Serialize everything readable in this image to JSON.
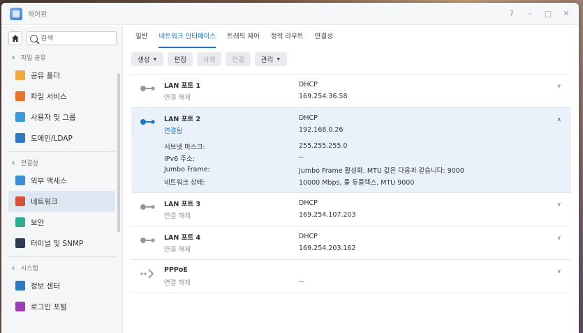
{
  "window": {
    "title": "제어판",
    "controls": [
      "?",
      "–",
      "□",
      "✕"
    ]
  },
  "sidebar": {
    "search_placeholder": "검색",
    "groups": [
      {
        "label": "파일 공유",
        "items": [
          {
            "label": "공유 폴더",
            "color": "#f2a93b"
          },
          {
            "label": "파일 서비스",
            "color": "#e8742b"
          },
          {
            "label": "사용자 및 그룹",
            "color": "#3a9bd9"
          },
          {
            "label": "도메인/LDAP",
            "color": "#2f78c4"
          }
        ]
      },
      {
        "label": "연결성",
        "items": [
          {
            "label": "외부 액세스",
            "color": "#3b8fd6"
          },
          {
            "label": "네트워크",
            "color": "#d5533b",
            "active": true
          },
          {
            "label": "보안",
            "color": "#2fae8f"
          },
          {
            "label": "터미널 및 SNMP",
            "color": "#2c3e55"
          }
        ]
      },
      {
        "label": "시스템",
        "items": [
          {
            "label": "정보 센터",
            "color": "#2f78c4"
          },
          {
            "label": "로그인 포털",
            "color": "#9b3fb5"
          }
        ]
      }
    ]
  },
  "tabs": [
    {
      "label": "일반",
      "active": false
    },
    {
      "label": "네트워크 인터페이스",
      "active": true
    },
    {
      "label": "트래픽 제어",
      "active": false
    },
    {
      "label": "정적 라우트",
      "active": false
    },
    {
      "label": "연결성",
      "active": false
    }
  ],
  "toolbar": {
    "create": "생성",
    "edit": "편집",
    "delete": "삭제",
    "connect": "연결",
    "manage": "관리"
  },
  "interfaces": [
    {
      "name": "LAN 포트 1",
      "status": "연결 해제",
      "mode": "DHCP",
      "ip": "169.254.36.58",
      "connected": false,
      "expanded": false
    },
    {
      "name": "LAN 포트 2",
      "status": "연결됨",
      "mode": "DHCP",
      "ip": "192.168.0.26",
      "connected": true,
      "expanded": true,
      "details": [
        {
          "label": "서브넷 마스크:",
          "value": "255.255.255.0"
        },
        {
          "label": "IPv6 주소:",
          "value": "--"
        },
        {
          "label": "Jumbo Frame:",
          "value": "Jumbo Frame 활성화. MTU 값은 다음과 같습니다: 9000"
        },
        {
          "label": "네트워크 상태:",
          "value": "10000 Mbps, 풀 듀플렉스, MTU 9000"
        }
      ]
    },
    {
      "name": "LAN 포트 3",
      "status": "연결 해제",
      "mode": "DHCP",
      "ip": "169.254.107.203",
      "connected": false,
      "expanded": false
    },
    {
      "name": "LAN 포트 4",
      "status": "연결 해제",
      "mode": "DHCP",
      "ip": "169.254.203.162",
      "connected": false,
      "expanded": false
    },
    {
      "name": "PPPoE",
      "status": "연결 해제",
      "mode": "",
      "ip": "--",
      "connected": false,
      "expanded": false,
      "pppoe": true
    }
  ],
  "colors": {
    "accent": "#1a73c8",
    "inactive_icon": "#999999"
  }
}
